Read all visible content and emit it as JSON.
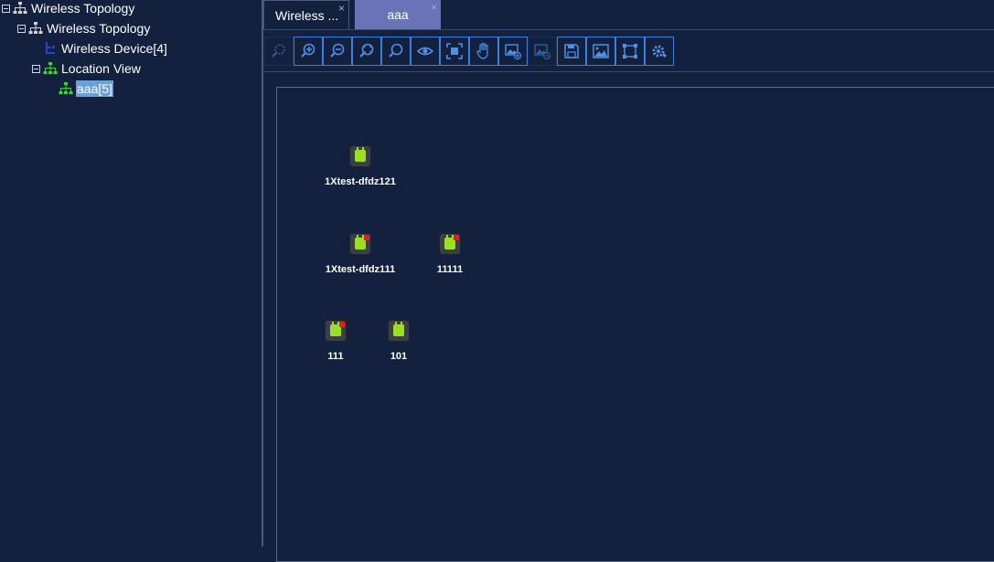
{
  "tree": {
    "items": [
      {
        "label": "Wireless Topology",
        "icon": "topology-icon"
      },
      {
        "label": "Wireless Topology",
        "icon": "topology-icon"
      },
      {
        "label": "Wireless Device[4]",
        "icon": "wireless-device-icon"
      },
      {
        "label": "Location View",
        "icon": "location-view-icon"
      },
      {
        "label": "aaa[5]",
        "icon": "location-view-icon",
        "selected": true
      }
    ]
  },
  "tabs": [
    {
      "label": "Wireless ...",
      "close": "×"
    },
    {
      "label": "aaa",
      "close": "×"
    }
  ],
  "toolbar": {
    "buttons": [
      {
        "icon": "zoom-select-icon",
        "enabled": false
      },
      {
        "icon": "zoom-in-icon",
        "enabled": true
      },
      {
        "icon": "zoom-out-icon",
        "enabled": true
      },
      {
        "icon": "zoom-fit-icon",
        "enabled": true
      },
      {
        "icon": "search-icon",
        "enabled": true
      },
      {
        "icon": "eye-icon",
        "enabled": true
      },
      {
        "icon": "fullscreen-icon",
        "enabled": true
      },
      {
        "icon": "hand-pan-icon",
        "enabled": true
      },
      {
        "icon": "add-image-icon",
        "enabled": true
      },
      {
        "icon": "remove-image-icon",
        "enabled": false
      },
      {
        "icon": "save-icon",
        "enabled": true
      },
      {
        "icon": "image-icon",
        "enabled": true
      },
      {
        "icon": "select-frame-icon",
        "enabled": true
      },
      {
        "icon": "settings-icon",
        "enabled": true
      }
    ]
  },
  "devices": [
    {
      "name": "1Xtest-dfdz121",
      "alarm": false
    },
    {
      "name": "1Xtest-dfdz111",
      "alarm": true
    },
    {
      "name": "11111",
      "alarm": true
    },
    {
      "name": "111",
      "alarm": true
    },
    {
      "name": "101",
      "alarm": false
    }
  ],
  "colors": {
    "background": "#13213f",
    "accent": "#3f7fd6",
    "active_tab": "#6a73b8",
    "selection": "#6d9fd8",
    "device_green": "#9be020",
    "alarm_red": "#e02020"
  }
}
